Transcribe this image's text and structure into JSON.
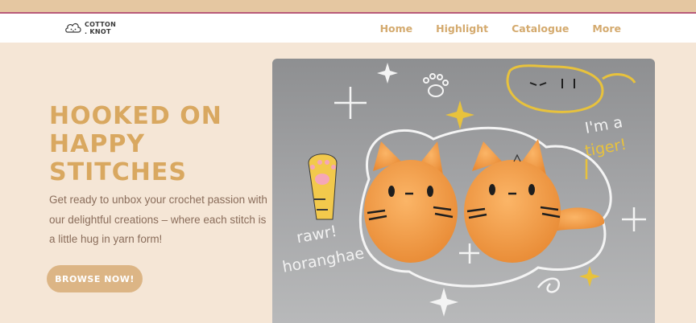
{
  "brand": {
    "name_line1": "COTTON",
    "name_line2": ". KNOT",
    "logo_icon": "cloud-cat-logo-icon"
  },
  "nav": {
    "items": [
      {
        "label": "Home"
      },
      {
        "label": "Highlight"
      },
      {
        "label": "Catalogue"
      },
      {
        "label": "More"
      }
    ]
  },
  "hero": {
    "title": "HOOKED ON\nHAPPY\nSTITCHES",
    "subtitle": "Get ready to unbox your crochet passion with our delightful creations – where each stitch is a little hug in yarn form!",
    "cta_label": "BROWSE NOW!"
  },
  "image": {
    "doodles": {
      "im_a": "I'm a",
      "tiger": "tiger!",
      "rawr": "rawr!",
      "horanghae": "horanghae"
    }
  },
  "colors": {
    "background": "#f5e6d6",
    "accent": "#d9a860",
    "nav_link": "#d4aa6e",
    "body_text": "#8a6d5b",
    "button": "#dcb585",
    "top_stripe": "#e5c7a1",
    "stripe_border": "#b85a78"
  }
}
